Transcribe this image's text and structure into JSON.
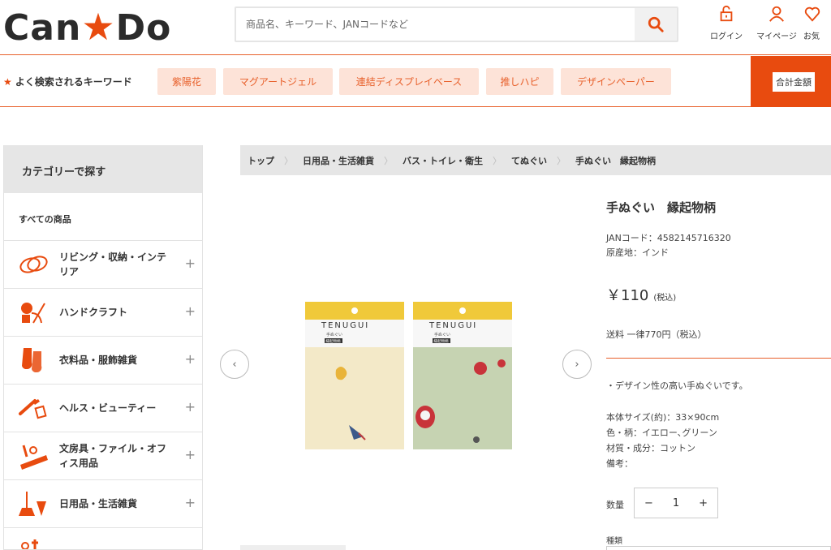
{
  "header": {
    "logo_text_1": "Can",
    "logo_text_2": "Do",
    "search_placeholder": "商品名、キーワード、JANコードなど",
    "links": {
      "login": "ログイン",
      "mypage": "マイページ",
      "favorites": "お気"
    }
  },
  "keywords": {
    "title": "よく検索されるキーワード",
    "tags": [
      "紫陽花",
      "マグアートジェル",
      "連結ディスプレイベース",
      "推しハピ",
      "デザインペーパー"
    ],
    "total_label": "合計金額"
  },
  "sidebar": {
    "heading": "カテゴリーで探す",
    "all_label": "すべての商品",
    "items": [
      {
        "label": "リビング・収納・インテリア",
        "icon": "living-icon"
      },
      {
        "label": "ハンドクラフト",
        "icon": "handcraft-icon"
      },
      {
        "label": "衣料品・服飾雑貨",
        "icon": "clothing-icon"
      },
      {
        "label": "ヘルス・ビューティー",
        "icon": "beauty-icon"
      },
      {
        "label": "文房具・ファイル・オフィス用品",
        "icon": "stationery-icon"
      },
      {
        "label": "日用品・生活雑貨",
        "icon": "daily-goods-icon"
      }
    ],
    "plus": "+"
  },
  "breadcrumb": [
    "トップ",
    "日用品・生活雑貨",
    "バス・トイレ・衛生",
    "てぬぐい",
    "手ぬぐい　縁起物柄"
  ],
  "product": {
    "title": "手ぬぐい　縁起物柄",
    "jan": "JANコード：4582145716320",
    "origin": "原産地：インド",
    "price": "￥110",
    "tax": "(税込)",
    "shipping": "送料 一律770円（税込）",
    "description": "・デザイン性の高い手ぬぐいです。",
    "specs": {
      "size": "本体サイズ(約)：33×90cm",
      "color": "色・柄：イエロー､グリーン",
      "material": "材質・成分：コットン",
      "note": "備考："
    },
    "qty_label": "数量",
    "qty_value": "1",
    "kind_label": "種類",
    "package_text": "TENUGUI",
    "package_sub": "手ぬぐい",
    "package_tag": "縁起物柄"
  },
  "colors": {
    "accent": "#e84b0f",
    "tag_bg": "#fde3d8",
    "tag_text": "#e8612c"
  }
}
